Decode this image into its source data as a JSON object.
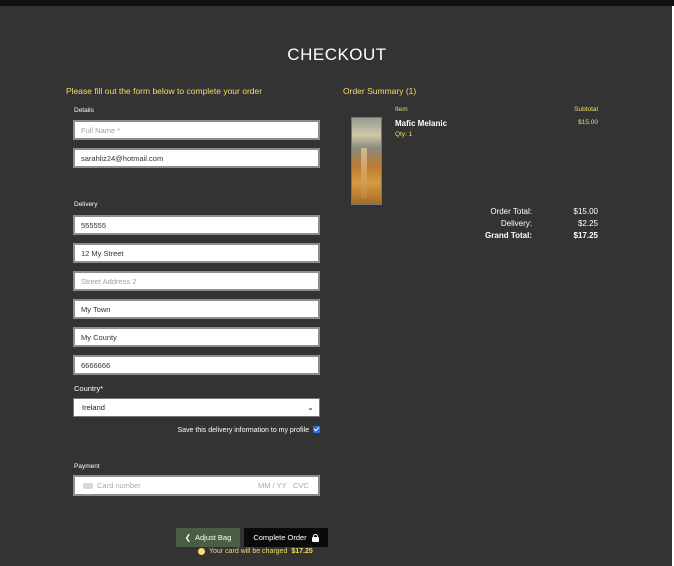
{
  "page": {
    "title": "CHECKOUT"
  },
  "form": {
    "intro": "Please fill out the form below to complete your order",
    "details_label": "Details",
    "full_name": {
      "value": "",
      "placeholder": "Full Name *"
    },
    "email": {
      "value": "sarahliz24@hotmail.com",
      "placeholder": "Email Address *"
    },
    "delivery_label": "Delivery",
    "phone": {
      "value": "555555",
      "placeholder": "Phone Number *"
    },
    "street1": {
      "value": "12 My Street",
      "placeholder": "Street Address 1 *"
    },
    "street2": {
      "value": "",
      "placeholder": "Street Address 2"
    },
    "town": {
      "value": "My Town",
      "placeholder": "Town or City *"
    },
    "county": {
      "value": "My County",
      "placeholder": "County, State or Locality"
    },
    "postcode": {
      "value": "6666666",
      "placeholder": "Postal Code"
    },
    "country_label": "Country*",
    "country_selected": "Ireland",
    "save_label": "Save this delivery information to my profile",
    "save_checked": true,
    "payment_label": "Payment",
    "card_placeholder": "Card number",
    "card_expiry_placeholder": "MM / YY",
    "card_cvc_placeholder": "CVC",
    "adjust_bag_label": "Adjust Bag",
    "complete_order_label": "Complete Order",
    "charge_note_prefix": "Your card will be charged",
    "charge_amount": "$17.25"
  },
  "summary": {
    "title": "Order Summary (1)",
    "col_item": "Item",
    "col_subtotal": "Subtotal",
    "items": [
      {
        "name": "Mafic Melanic",
        "qty": "Qty: 1",
        "subtotal": "$15.00",
        "image": "abstract-painting-thumbnail"
      }
    ],
    "order_total_label": "Order Total:",
    "order_total": "$15.00",
    "delivery_label": "Delivery:",
    "delivery": "$2.25",
    "grand_total_label": "Grand Total:",
    "grand_total": "$17.25"
  },
  "colors": {
    "background": "#333333",
    "accent": "#f3de6b",
    "adjust_button": "#4a5e44",
    "complete_button": "#0a0a0a"
  }
}
